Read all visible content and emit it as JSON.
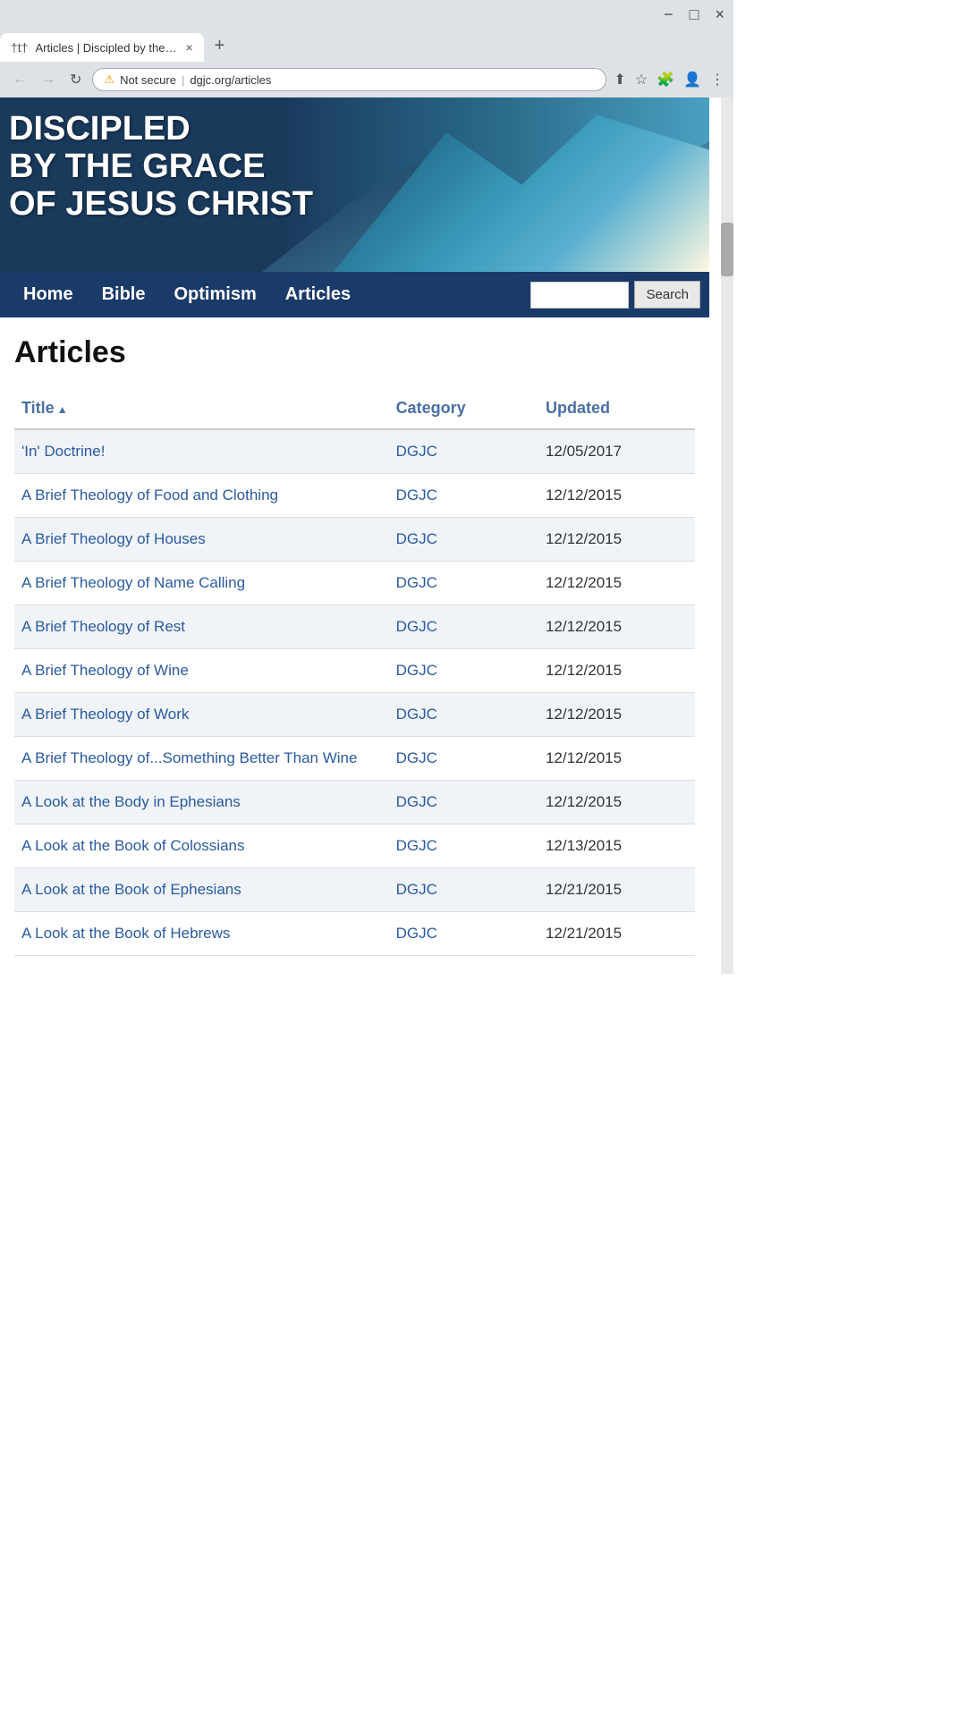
{
  "browser": {
    "tab_favicon": "†t†",
    "tab_title": "Articles | Discipled by the Grace ...",
    "tab_close": "×",
    "tab_new": "+",
    "nav_back": "←",
    "nav_forward": "→",
    "nav_reload": "↻",
    "security_label": "Not secure",
    "address_separator": "|",
    "address_url": "dgjc.org/articles",
    "window_minimize": "−",
    "window_maximize": "□",
    "window_close": "×"
  },
  "hero": {
    "line1": "DISCIPLED",
    "line2": "BY THE GRACE",
    "line3": "OF JESUS CHRIST"
  },
  "nav": {
    "home": "Home",
    "bible": "Bible",
    "optimism": "Optimism",
    "articles": "Articles",
    "search_placeholder": "",
    "search_btn": "Search"
  },
  "page": {
    "title": "Articles"
  },
  "table": {
    "col_title": "Title",
    "col_category": "Category",
    "col_updated": "Updated",
    "sort_arrow": "▲",
    "rows": [
      {
        "title": "'In' Doctrine!",
        "category": "DGJC",
        "updated": "12/05/2017"
      },
      {
        "title": "A Brief Theology of Food and Clothing",
        "category": "DGJC",
        "updated": "12/12/2015"
      },
      {
        "title": "A Brief Theology of Houses",
        "category": "DGJC",
        "updated": "12/12/2015"
      },
      {
        "title": "A Brief Theology of Name Calling",
        "category": "DGJC",
        "updated": "12/12/2015"
      },
      {
        "title": "A Brief Theology of Rest",
        "category": "DGJC",
        "updated": "12/12/2015"
      },
      {
        "title": "A Brief Theology of Wine",
        "category": "DGJC",
        "updated": "12/12/2015"
      },
      {
        "title": "A Brief Theology of Work",
        "category": "DGJC",
        "updated": "12/12/2015"
      },
      {
        "title": "A Brief Theology of...Something Better Than Wine",
        "category": "DGJC",
        "updated": "12/12/2015"
      },
      {
        "title": "A Look at the Body in Ephesians",
        "category": "DGJC",
        "updated": "12/12/2015"
      },
      {
        "title": "A Look at the Book of Colossians",
        "category": "DGJC",
        "updated": "12/13/2015"
      },
      {
        "title": "A Look at the Book of Ephesians",
        "category": "DGJC",
        "updated": "12/21/2015"
      },
      {
        "title": "A Look at the Book of Hebrews",
        "category": "DGJC",
        "updated": "12/21/2015"
      }
    ]
  }
}
